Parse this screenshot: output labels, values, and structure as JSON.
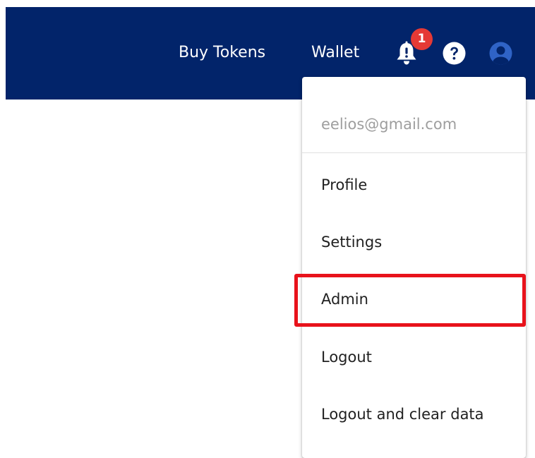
{
  "header": {
    "nav": {
      "buy_tokens": "Buy Tokens",
      "wallet": "Wallet"
    },
    "notifications": {
      "icon": "bell-icon",
      "count": "1"
    },
    "help_icon": "question-circle-icon",
    "user_icon": "user-circle-icon"
  },
  "user_menu": {
    "email": "eelios@gmail.com",
    "items": [
      {
        "label": "Profile"
      },
      {
        "label": "Settings"
      },
      {
        "label": "Admin"
      },
      {
        "label": "Logout"
      },
      {
        "label": "Logout and clear data"
      }
    ]
  },
  "colors": {
    "header_bg": "#02246a",
    "badge": "#e53935",
    "user_icon": "#2f63c6",
    "highlight": "#e8121b",
    "email_text": "#9e9e9e"
  }
}
